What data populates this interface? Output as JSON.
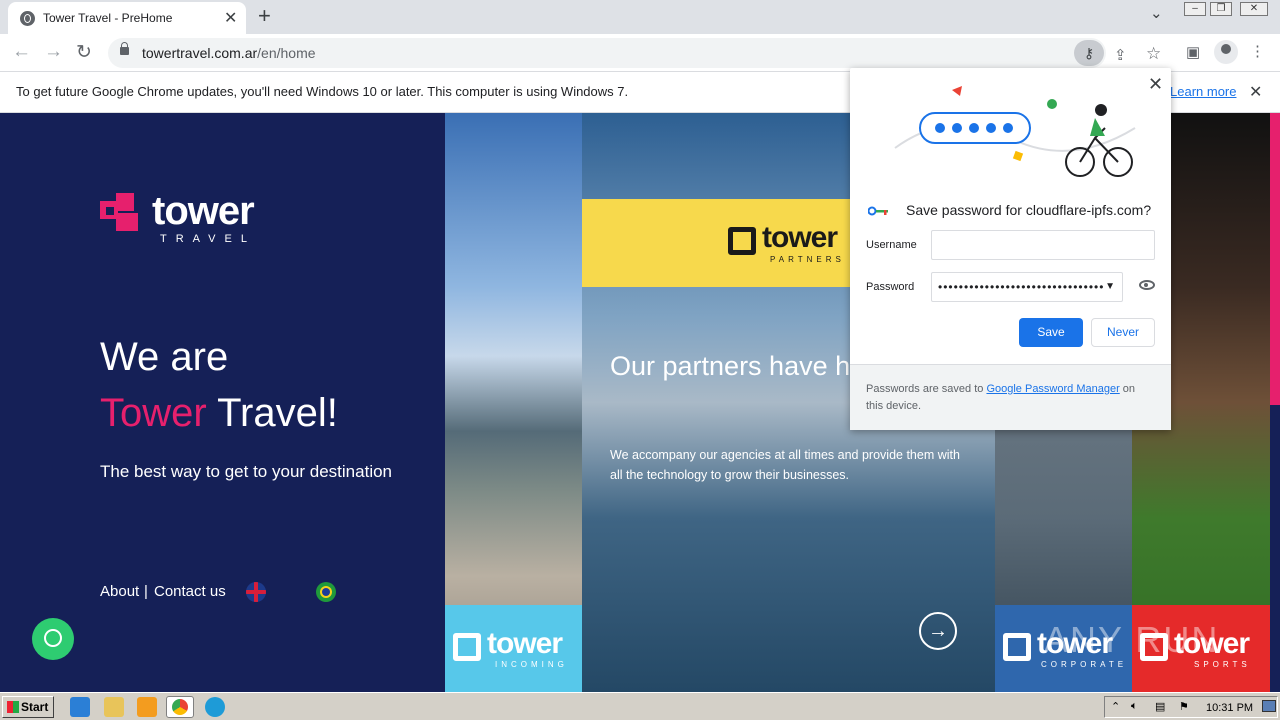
{
  "browser": {
    "tab_title": "Tower Travel - PreHome",
    "url_host": "towertravel.com.ar",
    "url_path": "/en/home"
  },
  "infobar": {
    "message": "To get future Google Chrome updates, you'll need Windows 10 or later. This computer is using Windows 7.",
    "learn_more": "Learn more"
  },
  "site": {
    "logo_word": "tower",
    "logo_sub": "TRAVEL",
    "headline_line1": "We are",
    "headline_pink": "Tower",
    "headline_rest": " Travel!",
    "tagline": "The best way to get to your destination",
    "nav": {
      "about": "About",
      "sep": "|",
      "contact": "Contact us"
    },
    "partners_word": "tower",
    "partners_sub": "PARTNERS",
    "section_title": "Our partners have h benefits",
    "section_body": "We accompany our agencies at all times and provide them with all the technology to grow their businesses.",
    "cards": [
      {
        "word": "tower",
        "sub": "INCOMING"
      },
      {
        "word": "tower",
        "sub": "CORPORATE"
      },
      {
        "word": "tower",
        "sub": "SPORTS"
      }
    ],
    "watermark": "ANY RUN"
  },
  "password_bubble": {
    "title": "Save password for cloudflare-ipfs.com?",
    "username_label": "Username",
    "username_value": "",
    "password_label": "Password",
    "password_value": "••••••••••••••••••••••••••••••••",
    "save": "Save",
    "never": "Never",
    "footer_pre": "Passwords are saved to ",
    "footer_link": "Google Password Manager",
    "footer_post": " on this device."
  },
  "taskbar": {
    "start": "Start",
    "clock": "10:31 PM"
  },
  "colors": {
    "brand_navy": "#152057",
    "brand_pink": "#e6206d",
    "chrome_blue": "#1a73e8"
  }
}
